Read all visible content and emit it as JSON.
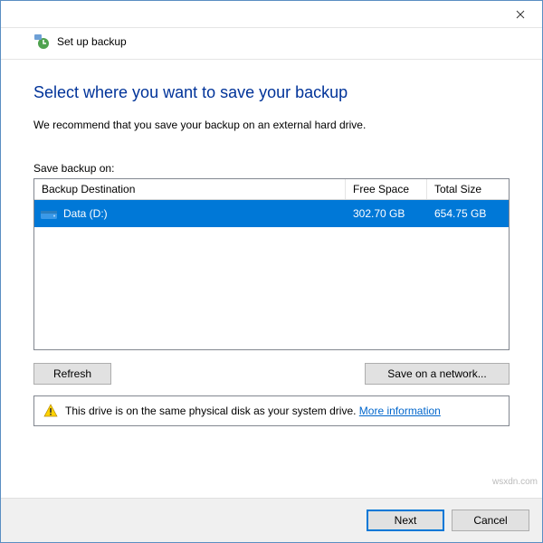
{
  "window": {
    "title": "Set up backup"
  },
  "page": {
    "title": "Select where you want to save your backup",
    "recommend": "We recommend that you save your backup on an external hard drive.",
    "save_label": "Save backup on:"
  },
  "columns": {
    "destination": "Backup Destination",
    "free": "Free Space",
    "total": "Total Size"
  },
  "drives": [
    {
      "name": "Data (D:)",
      "free": "302.70 GB",
      "total": "654.75 GB"
    }
  ],
  "buttons": {
    "refresh": "Refresh",
    "save_network": "Save on a network...",
    "next": "Next",
    "cancel": "Cancel"
  },
  "warning": {
    "text": "This drive is on the same physical disk as your system drive. ",
    "link": "More information"
  },
  "watermark": "wsxdn.com"
}
